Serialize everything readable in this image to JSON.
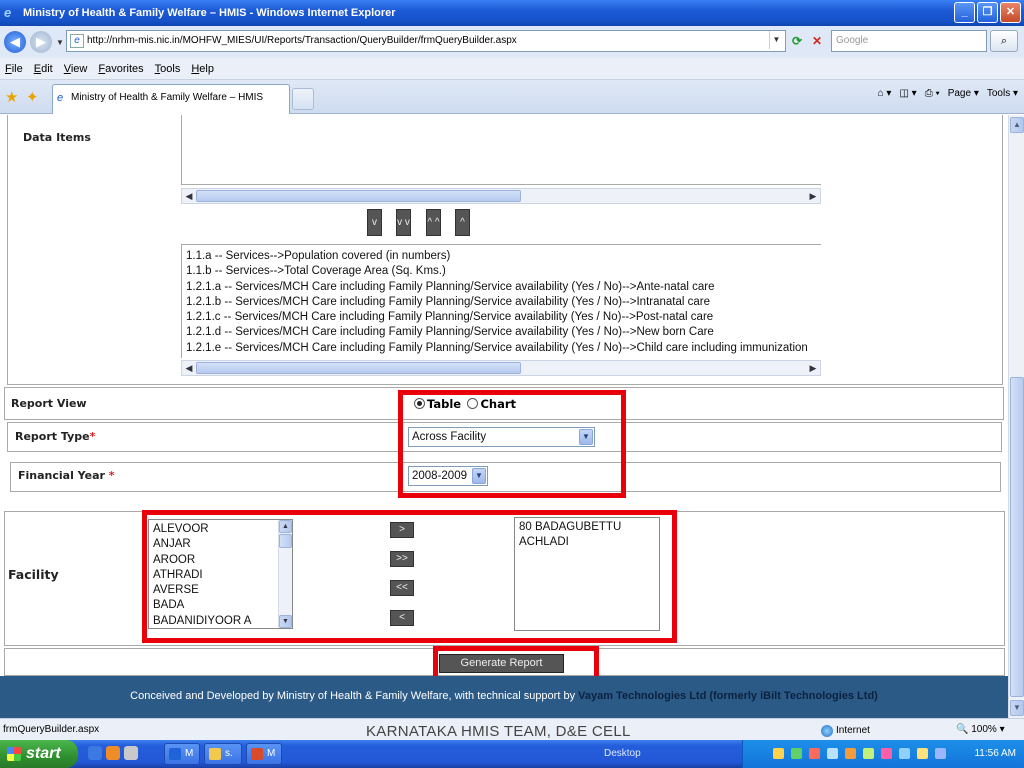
{
  "window": {
    "title": "Ministry of Health & Family Welfare – HMIS - Windows Internet Explorer",
    "minimize": "_",
    "maximize": "❐",
    "close": "✕"
  },
  "address": {
    "url": "http://nrhm-mis.nic.in/MOHFW_MIES/UI/Reports/Transaction/QueryBuilder/frmQueryBuilder.aspx",
    "search_placeholder": "Google"
  },
  "menu": [
    "File",
    "Edit",
    "View",
    "Favorites",
    "Tools",
    "Help"
  ],
  "tab": {
    "label": "Ministry of Health & Family Welfare – HMIS"
  },
  "command_bar": {
    "page": "Page ▾",
    "tools": "Tools ▾"
  },
  "form": {
    "data_items_label": "Data Items",
    "move_buttons": [
      "v",
      "v v",
      "^ ^",
      "^"
    ],
    "data_items": [
      "1.1.a -- Services-->Population covered (in numbers)",
      "1.1.b -- Services-->Total Coverage Area (Sq. Kms.)",
      "1.2.1.a -- Services/MCH Care including Family Planning/Service availability (Yes / No)-->Ante-natal care",
      "1.2.1.b -- Services/MCH Care including Family Planning/Service availability (Yes / No)-->Intranatal care",
      "1.2.1.c -- Services/MCH Care including Family Planning/Service availability (Yes / No)-->Post-natal care",
      "1.2.1.d -- Services/MCH Care including Family Planning/Service availability (Yes / No)-->New born Care",
      "1.2.1.e -- Services/MCH Care including Family Planning/Service availability (Yes / No)-->Child care including immunization"
    ],
    "report_view_label": "Report View",
    "report_view_options": [
      "Table",
      "Chart"
    ],
    "report_view_selected": "Table",
    "report_type_label": "Report Type",
    "report_type_value": "Across Facility",
    "financial_year_label": "Financial Year",
    "financial_year_value": "2008-2009",
    "required_mark": "*",
    "facility_label": "Facility",
    "facility_available": [
      "ALEVOOR",
      "ANJAR",
      "AROOR",
      "ATHRADI",
      "AVERSE",
      "BADA",
      "BADANIDIYOOR A"
    ],
    "facility_selected": [
      "80 BADAGUBETTU",
      "ACHLADI"
    ],
    "facility_buttons": [
      ">",
      ">>",
      "<<",
      "<"
    ],
    "generate_button": "Generate Report"
  },
  "footer": {
    "text": "Conceived and Developed by Ministry of Health & Family Welfare, with technical support by",
    "company": "Vayam Technologies Ltd (formerly iBilt Technologies Ltd)"
  },
  "status": {
    "text": "frmQueryBuilder.aspx",
    "zone": "Internet",
    "zoom": "100%"
  },
  "watermark": "KARNATAKA HMIS TEAM, D&E CELL",
  "taskbar": {
    "start": "start",
    "tasks": [
      "M",
      "s.",
      "M"
    ],
    "desktop": "Desktop",
    "clock": "11:56 AM"
  },
  "colors": {
    "highlight_red": "#e8000b",
    "footer_blue": "#2c5a87",
    "button_gray": "#555555"
  }
}
